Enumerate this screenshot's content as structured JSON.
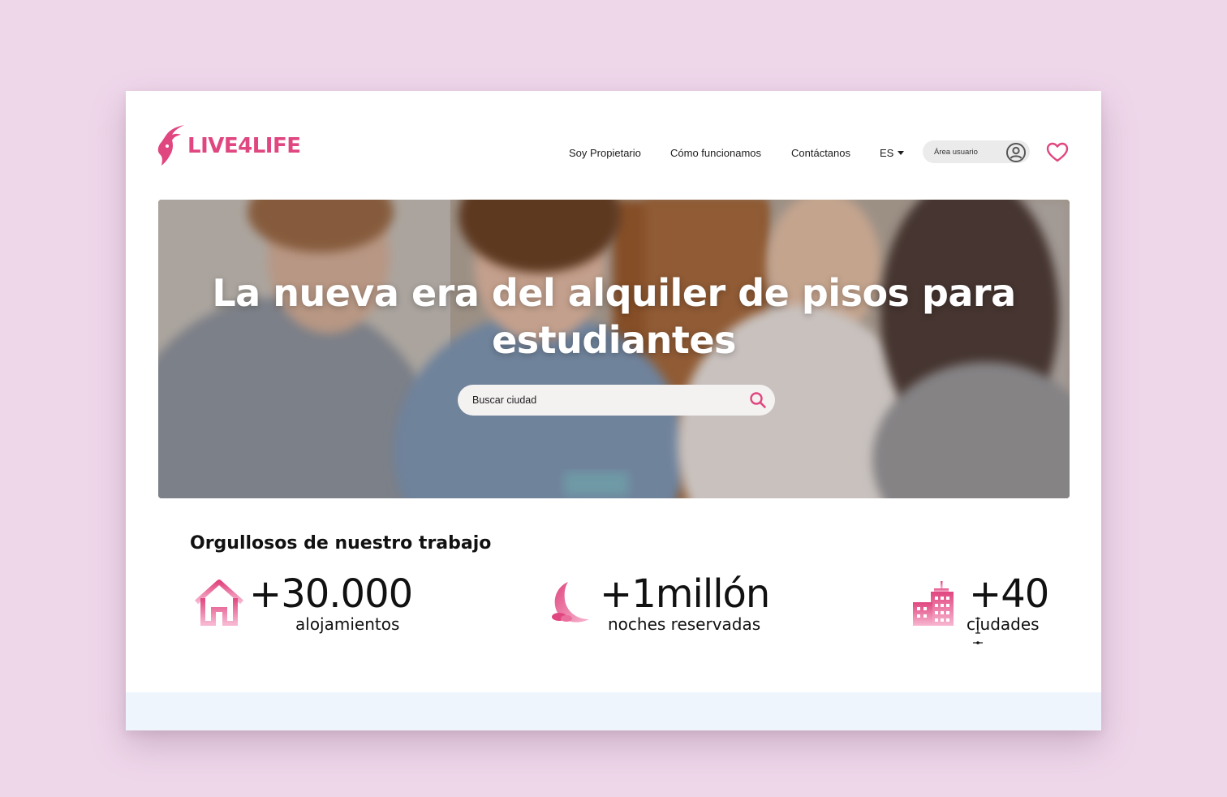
{
  "brand": {
    "name": "LIVE4LIFE",
    "color": "#e0467f"
  },
  "nav": {
    "items": [
      "Soy Propietario",
      "Cómo funcionamos",
      "Contáctanos"
    ],
    "language": "ES",
    "user_area_label": "Área usuario"
  },
  "hero": {
    "title": "La nueva era del alquiler de pisos para estudiantes",
    "search_placeholder": "Buscar ciudad"
  },
  "stats": {
    "title": "Orgullosos de nuestro trabajo",
    "items": [
      {
        "icon": "house-icon",
        "value": "+30.000",
        "label": "alojamientos"
      },
      {
        "icon": "moon-icon",
        "value": "+1millón",
        "label": "noches reservadas"
      },
      {
        "icon": "buildings-icon",
        "value": "+40",
        "label": "ciudades"
      }
    ]
  },
  "colors": {
    "accent": "#e0467f",
    "page_bg": "#efd7ea",
    "band": "#eef5fd"
  }
}
